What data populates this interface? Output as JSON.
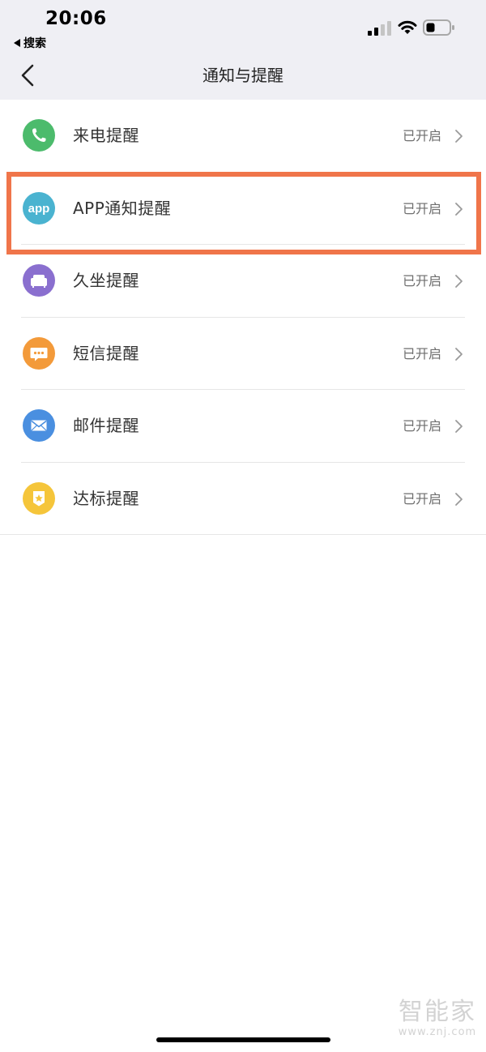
{
  "status_bar": {
    "time": "20:06",
    "back_app_label": "搜索"
  },
  "nav": {
    "title": "通知与提醒"
  },
  "items": [
    {
      "label": "来电提醒",
      "status": "已开启",
      "icon": "phone-icon",
      "color": "#4cbb6c"
    },
    {
      "label": "APP通知提醒",
      "status": "已开启",
      "icon": "app-icon",
      "color": "#4ab3d0",
      "icon_text": "app"
    },
    {
      "label": "久坐提醒",
      "status": "已开启",
      "icon": "sofa-icon",
      "color": "#8a6fcf"
    },
    {
      "label": "短信提醒",
      "status": "已开启",
      "icon": "message-icon",
      "color": "#f39a3a"
    },
    {
      "label": "邮件提醒",
      "status": "已开启",
      "icon": "mail-icon",
      "color": "#4a8fe0"
    },
    {
      "label": "达标提醒",
      "status": "已开启",
      "icon": "badge-star-icon",
      "color": "#f5c53a"
    }
  ],
  "highlight": {
    "color": "#f0754a",
    "target": "APP通知提醒"
  },
  "watermark": {
    "brand": "智能家",
    "url": "www.znj.com"
  }
}
